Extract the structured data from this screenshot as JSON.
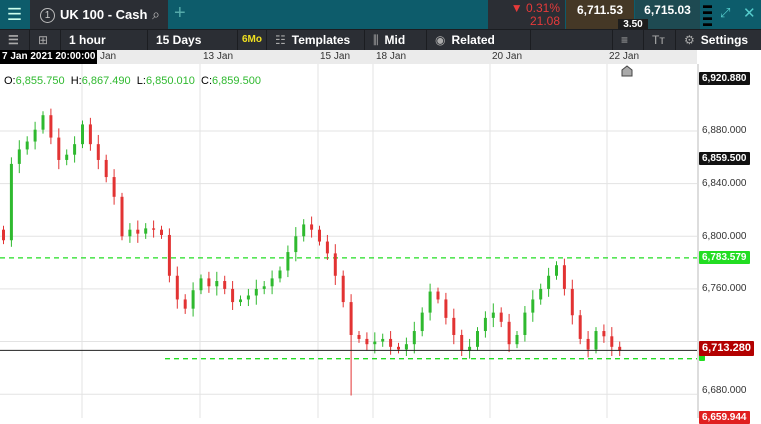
{
  "header": {
    "menu_icon": "hamburger-icon",
    "tab_number": "1",
    "instrument": "UK 100 - Cash",
    "change_pct": "▼ 0.31%",
    "change_abs": "21.08",
    "sell_price": "6,711.53",
    "buy_price": "6,715.03",
    "spread": "3.50",
    "colors": {
      "negative": "#e63a3a",
      "topbar": "#0d5c6b"
    }
  },
  "toolbar": {
    "interval": "1 hour",
    "range": "15 Days",
    "range_badge": "6Mo",
    "templates": "Templates",
    "price_type": "Mid",
    "related": "Related",
    "settings": "Settings"
  },
  "chart": {
    "cursor_time": "7 Jan 2021 20:00:00",
    "ohlc": {
      "o_label": "O:",
      "o": "6,855.750",
      "h_label": "H:",
      "h": "6,867.490",
      "l_label": "L:",
      "l": "6,850.010",
      "c_label": "C:",
      "c": "6,859.500"
    },
    "time_labels": [
      "Jan",
      "13 Jan",
      "15 Jan",
      "18 Jan",
      "20 Jan",
      "22 Jan"
    ],
    "price_ticks": [
      "6,880.000",
      "6,840.000",
      "6,800.000",
      "6,760.000",
      "6,680.000"
    ],
    "price_tags": {
      "high": "6,920.880",
      "cursor": "6,859.500",
      "resistance": "6,783.579",
      "current": "6,713.280",
      "low": "6,659.944"
    },
    "colors": {
      "up": "#2fb92f",
      "down": "#e23333",
      "level": "#22dd22",
      "current": "#b30000"
    }
  },
  "chart_data": {
    "type": "candlestick",
    "ylim": [
      6660,
      6930
    ],
    "levels": [
      6783.579,
      6707.0
    ],
    "current": 6713.28,
    "closes": [
      6797,
      6855,
      6866,
      6872,
      6881,
      6892,
      6875,
      6858,
      6862,
      6870,
      6885,
      6870,
      6858,
      6845,
      6830,
      6800,
      6805,
      6802,
      6806,
      6805,
      6801,
      6770,
      6752,
      6745,
      6759,
      6768,
      6762,
      6766,
      6760,
      6750,
      6752,
      6755,
      6760,
      6762,
      6768,
      6774,
      6788,
      6800,
      6809,
      6805,
      6796,
      6787,
      6770,
      6750,
      6725,
      6722,
      6718,
      6720,
      6722,
      6716,
      6714,
      6718,
      6728,
      6742,
      6758,
      6752,
      6738,
      6725,
      6713,
      6716,
      6728,
      6738,
      6742,
      6735,
      6718,
      6725,
      6742,
      6752,
      6760,
      6770,
      6778,
      6760,
      6740,
      6722,
      6714,
      6728,
      6724,
      6716,
      6713
    ]
  }
}
